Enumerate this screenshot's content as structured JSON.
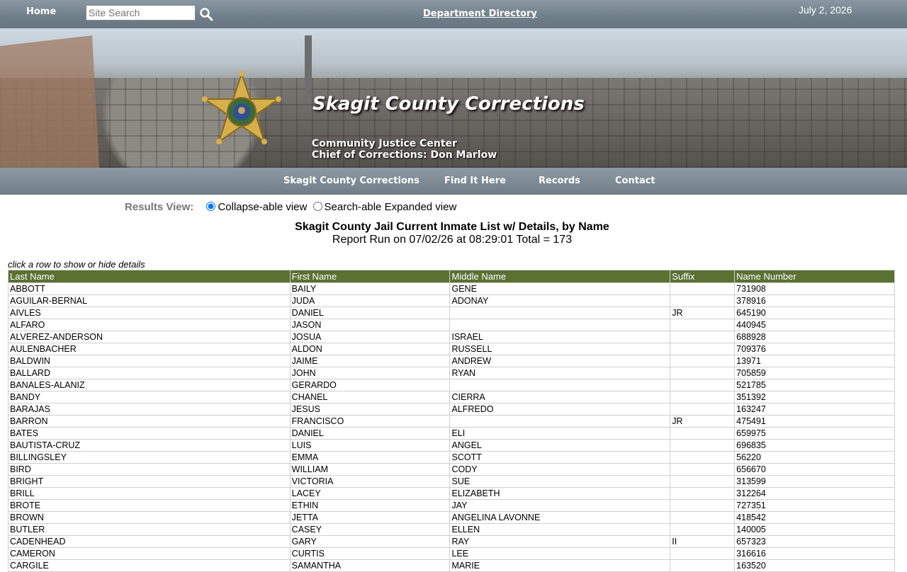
{
  "topbar": {
    "home_label": "Home",
    "search_placeholder": "Site Search",
    "department_directory_label": "Department Directory",
    "date": "July 2, 2026"
  },
  "banner": {
    "title": "Skagit County Corrections",
    "subtitle_line1": "Community Justice Center",
    "subtitle_line2": "Chief of Corrections: Don Marlow"
  },
  "nav": {
    "items": [
      {
        "label": "Skagit County Corrections"
      },
      {
        "label": "Find It Here"
      },
      {
        "label": "Records"
      },
      {
        "label": "Contact"
      }
    ]
  },
  "results_view": {
    "label": "Results View:",
    "option_collapse": "Collapse-able view",
    "option_expanded": "Search-able Expanded view",
    "selected": "collapse"
  },
  "report": {
    "title": "Skagit County Jail Current Inmate List w/ Details, by Name",
    "run_line": "Report Run on 07/02/26 at 08:29:01 Total = 173",
    "hint": "click a row to show or hide details"
  },
  "table": {
    "headers": [
      "Last Name",
      "First Name",
      "Middle Name",
      "Suffix",
      "Name Number"
    ],
    "rows": [
      [
        "ABBOTT",
        "BAILY",
        "GENE",
        "",
        "731908"
      ],
      [
        "AGUILAR-BERNAL",
        "JUDA",
        "ADONAY",
        "",
        "378916"
      ],
      [
        "AIVLES",
        "DANIEL",
        "",
        "JR",
        "645190"
      ],
      [
        "ALFARO",
        "JASON",
        "",
        "",
        "440945"
      ],
      [
        "ALVEREZ-ANDERSON",
        "JOSUA",
        "ISRAEL",
        "",
        "688928"
      ],
      [
        "AULENBACHER",
        "ALDON",
        "RUSSELL",
        "",
        "709376"
      ],
      [
        "BALDWIN",
        "JAIME",
        "ANDREW",
        "",
        "13971"
      ],
      [
        "BALLARD",
        "JOHN",
        "RYAN",
        "",
        "705859"
      ],
      [
        "BANALES-ALANIZ",
        "GERARDO",
        "",
        "",
        "521785"
      ],
      [
        "BANDY",
        "CHANEL",
        "CIERRA",
        "",
        "351392"
      ],
      [
        "BARAJAS",
        "JESUS",
        "ALFREDO",
        "",
        "163247"
      ],
      [
        "BARRON",
        "FRANCISCO",
        "",
        "JR",
        "475491"
      ],
      [
        "BATES",
        "DANIEL",
        "ELI",
        "",
        "659975"
      ],
      [
        "BAUTISTA-CRUZ",
        "LUIS",
        "ANGEL",
        "",
        "696835"
      ],
      [
        "BILLINGSLEY",
        "EMMA",
        "SCOTT",
        "",
        "56220"
      ],
      [
        "BIRD",
        "WILLIAM",
        "CODY",
        "",
        "656670"
      ],
      [
        "BRIGHT",
        "VICTORIA",
        "SUE",
        "",
        "313599"
      ],
      [
        "BRILL",
        "LACEY",
        "ELIZABETH",
        "",
        "312264"
      ],
      [
        "BROTE",
        "ETHIN",
        "JAY",
        "",
        "727351"
      ],
      [
        "BROWN",
        "JETTA",
        "ANGELINA LAVONNE",
        "",
        "418542"
      ],
      [
        "BUTLER",
        "CASEY",
        "ELLEN",
        "",
        "140005"
      ],
      [
        "CADENHEAD",
        "GARY",
        "RAY",
        "II",
        "657323"
      ],
      [
        "CAMERON",
        "CURTIS",
        "LEE",
        "",
        "316616"
      ],
      [
        "CARGILE",
        "SAMANTHA",
        "MARIE",
        "",
        "163520"
      ]
    ]
  },
  "colors": {
    "header_green": "#5a7132",
    "bar_gray": "#6e7d87"
  }
}
